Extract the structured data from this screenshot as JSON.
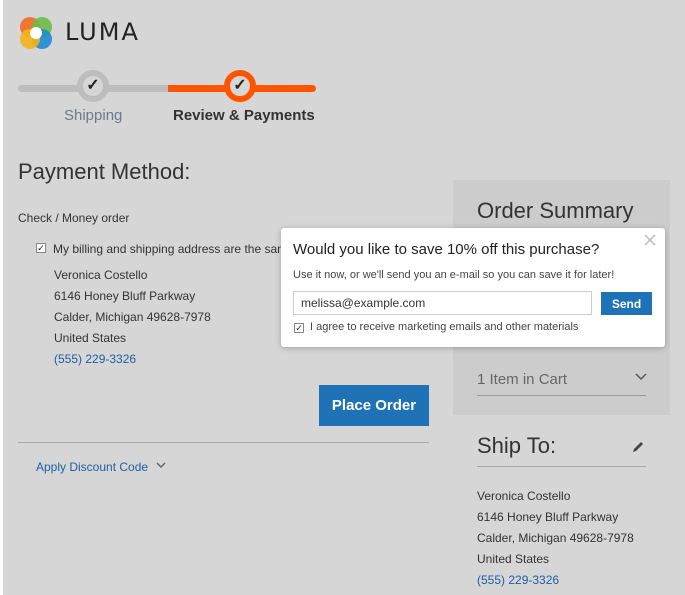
{
  "brand": {
    "name": "LUMA"
  },
  "progress": {
    "steps": [
      {
        "label": "Shipping",
        "state": "complete"
      },
      {
        "label": "Review & Payments",
        "state": "active"
      }
    ],
    "check_glyph": "✓"
  },
  "payment": {
    "title": "Payment Method:",
    "method_label": "Check / Money order",
    "billing_same_label": "My billing and shipping address are the sam",
    "billing_same_checked": true,
    "address": {
      "name": "Veronica Costello",
      "street": "6146 Honey Bluff Parkway",
      "city_line": "Calder, Michigan 49628-7978",
      "country": "United States",
      "phone": "(555) 229-3326"
    },
    "place_order_label": "Place Order"
  },
  "discount": {
    "label": "Apply Discount Code"
  },
  "summary": {
    "title": "Order Summary",
    "cart_label": "1 Item in Cart"
  },
  "ship_to": {
    "title": "Ship To:",
    "address": {
      "name": "Veronica Costello",
      "street": "6146 Honey Bluff Parkway",
      "city_line": "Calder, Michigan 49628-7978",
      "country": "United States",
      "phone": "(555) 229-3326"
    }
  },
  "popup": {
    "title": "Would you like to save 10% off this purchase?",
    "subtitle": "Use it now, or we'll send you an e-mail so you can save it for later!",
    "email_value": "melissa@example.com",
    "send_label": "Send",
    "agree_label": "I agree to receive marketing emails and other materials",
    "agree_checked": true
  },
  "icons": {
    "close": "close-icon",
    "chevron": "chevron-down-icon",
    "pencil": "pencil-icon",
    "check": "checkmark-icon"
  },
  "colors": {
    "accent": "#ff5501",
    "primary_button": "#1f72b6",
    "link": "#1f5ea5",
    "progress_inactive": "#bdbdbd"
  }
}
